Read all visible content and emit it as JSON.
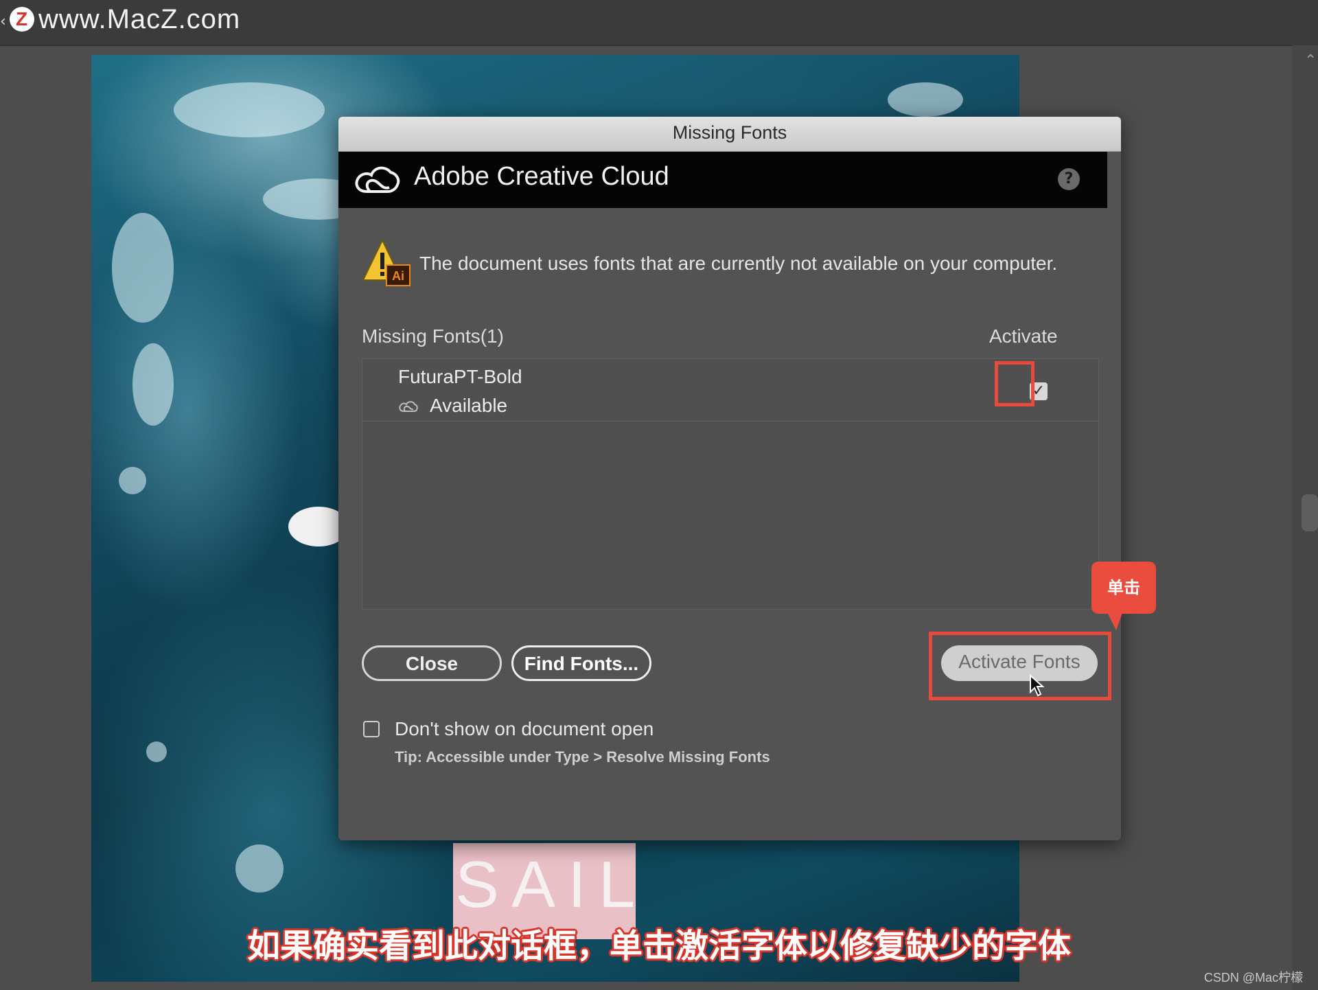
{
  "watermark": {
    "badge": "Z",
    "text": "www.MacZ.com"
  },
  "dialog": {
    "title": "Missing Fonts",
    "brand": "Adobe Creative Cloud",
    "help_label": "?",
    "warning_message": "The document uses fonts that are currently not available on your computer.",
    "columns": {
      "missing": "Missing Fonts(1)",
      "activate": "Activate"
    },
    "fonts": [
      {
        "name": "FuturaPT-Bold",
        "status": "Available",
        "activate_checked": true
      }
    ],
    "check_mark": "✓",
    "buttons": {
      "close": "Close",
      "find": "Find Fonts...",
      "activate": "Activate Fonts"
    },
    "dont_show_label": "Don't show on document open",
    "tip": "Tip: Accessible under Type > Resolve Missing Fonts"
  },
  "artwork": {
    "sail_text": "SAIL"
  },
  "callout": {
    "label": "单击"
  },
  "subtitle": "如果确实看到此对话框，单击激活字体以修复缺少的字体",
  "credit": "CSDN @Mac柠檬",
  "colors": {
    "highlight": "#e84b3c",
    "dialog_bg": "#535353",
    "header_bg": "#050505"
  }
}
